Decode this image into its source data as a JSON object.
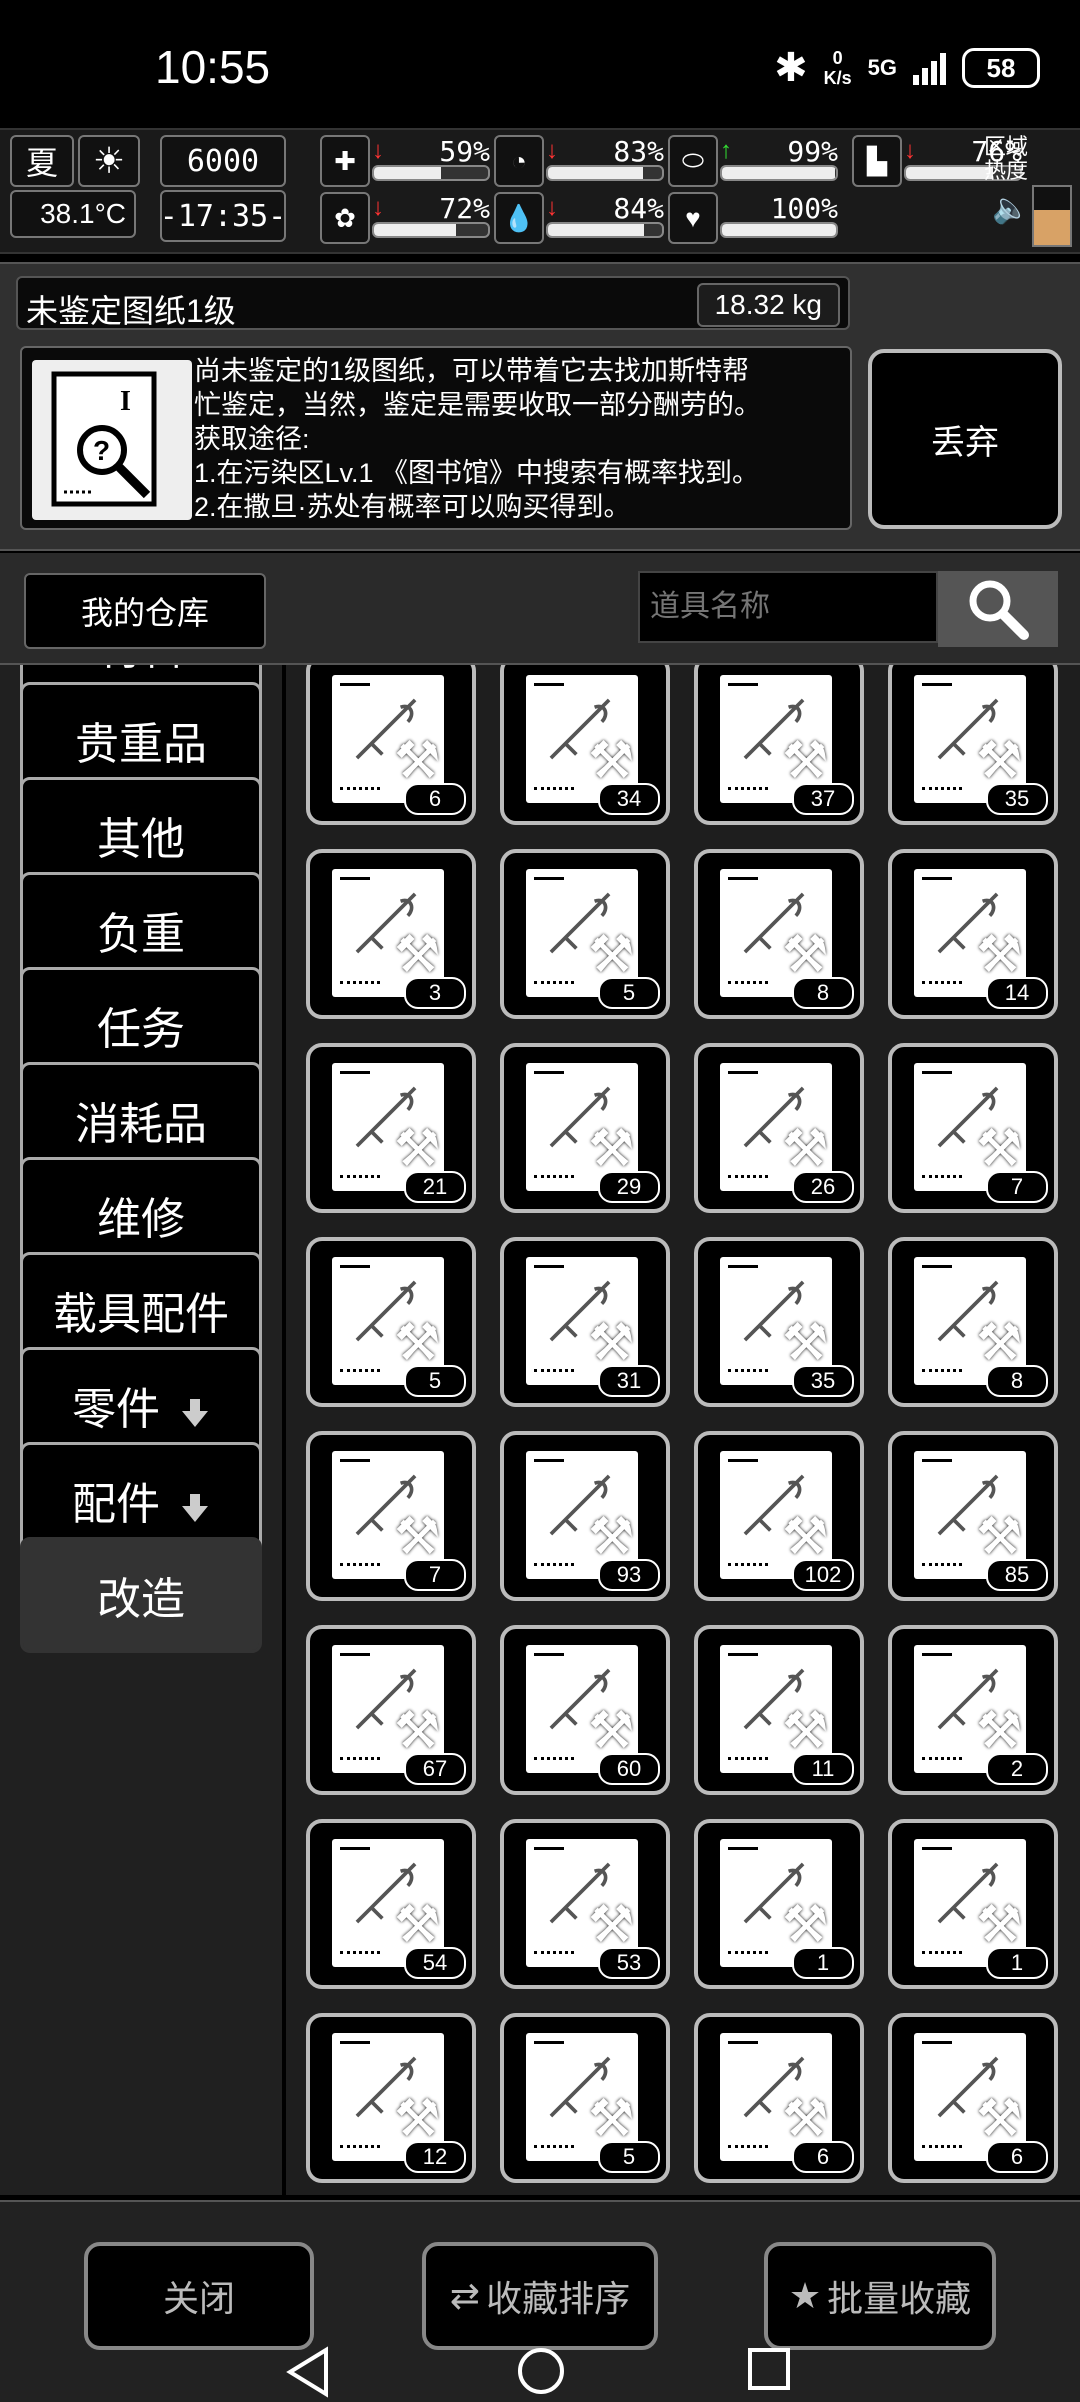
{
  "status": {
    "time": "10:55",
    "speed_top": "0",
    "speed_bottom": "K/s",
    "signal": "5G",
    "battery": "58"
  },
  "hud": {
    "season": "夏",
    "temperature": "38.1°C",
    "money": "6000",
    "clock": "-17:35-",
    "stats": [
      {
        "name": "health",
        "icon": "medkit-icon",
        "arrow": "down",
        "value": "59%",
        "fill": 0.59,
        "arrow_color": "#ff3333"
      },
      {
        "name": "hunger",
        "icon": "stomach-icon",
        "arrow": "down",
        "value": "83%",
        "fill": 0.83,
        "arrow_color": "#ff3333"
      },
      {
        "name": "stamina",
        "icon": "capsule-icon",
        "arrow": "up",
        "value": "99%",
        "fill": 0.99,
        "arrow_color": "#33dd33"
      },
      {
        "name": "mental",
        "icon": "brain-icon",
        "arrow": "down",
        "value": "72%",
        "fill": 0.72,
        "arrow_color": "#ff3333"
      },
      {
        "name": "thirst",
        "icon": "water-drop-icon",
        "arrow": "down",
        "value": "84%",
        "fill": 0.84,
        "arrow_color": "#ff3333"
      },
      {
        "name": "heart",
        "icon": "heart-icon",
        "arrow": "",
        "value": "100%",
        "fill": 1.0,
        "arrow_color": "#ff3333"
      },
      {
        "name": "leg",
        "icon": "boot-icon",
        "arrow": "down",
        "value": "76%",
        "fill": 0.76,
        "arrow_color": "#ff3333"
      }
    ],
    "region_label": "区域\n热度",
    "region_heat_fill": 0.6
  },
  "detail": {
    "name": "未鉴定图纸1级",
    "weight": "18.32 kg",
    "description": "尚未鉴定的1级图纸，可以带着它去找加斯特帮\n忙鉴定，当然，鉴定是需要收取一部分酬劳的。\n获取途径:\n1.在污染区Lv.1 《图书馆》中搜索有概率找到。\n2.在撒旦·苏处有概率可以购买得到。",
    "discard_label": "丢弃"
  },
  "warehouse": {
    "label": "我的仓库",
    "search_placeholder": "道具名称"
  },
  "categories": [
    {
      "label": "材料",
      "active": false,
      "arrow": false
    },
    {
      "label": "贵重品",
      "active": false,
      "arrow": false
    },
    {
      "label": "其他",
      "active": false,
      "arrow": false
    },
    {
      "label": "负重",
      "active": false,
      "arrow": false
    },
    {
      "label": "任务",
      "active": false,
      "arrow": false
    },
    {
      "label": "消耗品",
      "active": false,
      "arrow": false
    },
    {
      "label": "维修",
      "active": false,
      "arrow": false
    },
    {
      "label": "载具配件",
      "active": false,
      "arrow": false
    },
    {
      "label": "零件",
      "active": false,
      "arrow": true
    },
    {
      "label": "配件",
      "active": false,
      "arrow": true
    },
    {
      "label": "改造",
      "active": true,
      "arrow": false
    }
  ],
  "items": [
    {
      "count": "6",
      "icon": "sword-blueprint-icon"
    },
    {
      "count": "34",
      "icon": "armor-blueprint-icon"
    },
    {
      "count": "37",
      "icon": "hammer-blueprint-icon"
    },
    {
      "count": "35",
      "icon": "mace-blueprint-icon"
    },
    {
      "count": "3",
      "icon": "vest-blueprint-icon"
    },
    {
      "count": "5",
      "icon": "axe-blueprint-icon"
    },
    {
      "count": "8",
      "icon": "spiked-ball-blueprint-icon"
    },
    {
      "count": "14",
      "icon": "battle-axe-blueprint-icon"
    },
    {
      "count": "21",
      "icon": "halberd-blueprint-icon"
    },
    {
      "count": "29",
      "icon": "cleaver-blueprint-icon"
    },
    {
      "count": "26",
      "icon": "scythe-blueprint-icon"
    },
    {
      "count": "7",
      "icon": "sickle-blueprint-icon"
    },
    {
      "count": "5",
      "icon": "claw-blueprint-icon"
    },
    {
      "count": "31",
      "icon": "greataxe-blueprint-icon"
    },
    {
      "count": "35",
      "icon": "warhammer-blueprint-icon"
    },
    {
      "count": "8",
      "icon": "figure-blueprint-icon"
    },
    {
      "count": "7",
      "icon": "poleaxe-blueprint-icon"
    },
    {
      "count": "93",
      "icon": "spear-blueprint-icon"
    },
    {
      "count": "102",
      "icon": "lance-blueprint-icon"
    },
    {
      "count": "85",
      "icon": "serpent-blade-blueprint-icon"
    },
    {
      "count": "67",
      "icon": "dagger-blueprint-icon"
    },
    {
      "count": "60",
      "icon": "trident-blueprint-icon"
    },
    {
      "count": "11",
      "icon": "pike-blueprint-icon"
    },
    {
      "count": "2",
      "icon": "glaive-blueprint-icon"
    },
    {
      "count": "54",
      "icon": "wavy-sword-blueprint-icon"
    },
    {
      "count": "53",
      "icon": "fork-blueprint-icon"
    },
    {
      "count": "1",
      "icon": "whip-blueprint-icon"
    },
    {
      "count": "1",
      "icon": "long-glaive-blueprint-icon"
    },
    {
      "count": "12",
      "icon": "magazine-blueprint-icon"
    },
    {
      "count": "5",
      "icon": "scope-blueprint-icon"
    },
    {
      "count": "6",
      "icon": "tactical-vest-blueprint-icon"
    },
    {
      "count": "6",
      "icon": "heavy-vest-blueprint-icon"
    }
  ],
  "buttons": {
    "close": "关闭",
    "sort": "收藏排序",
    "batch": "批量收藏"
  },
  "colors": {
    "heat": "#d8a266",
    "arrow_down": "#ff3333",
    "arrow_up": "#33dd33"
  }
}
